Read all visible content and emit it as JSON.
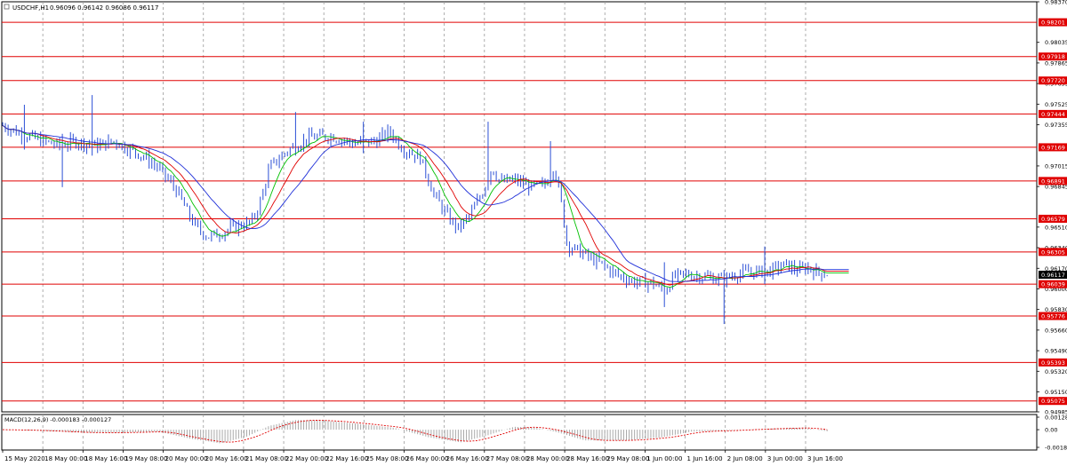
{
  "header": {
    "symbol_label": "USDCHF,H1",
    "ohlc_label": "0.96096 0.96142 0.96086 0.96117",
    "macd_label": "MACD(12,26,9) -0.000183 -0.000127"
  },
  "colors": {
    "candle": "#2b4fd6",
    "ma_fast": "#00c000",
    "ma_mid": "#e00000",
    "ma_slow": "#1f2fd8",
    "level_line": "#e00000",
    "level_tag_bg": "#e00000",
    "price_tag_bg": "#000000",
    "grid": "#9a9a9a",
    "macd_bar": "#aaaaaa",
    "macd_signal": "#e00000"
  },
  "chart_data": [
    {
      "type": "candlestick",
      "title": "USDCHF,H1",
      "ylim": [
        0.94985,
        0.9837
      ],
      "grid": true,
      "y_ticks": [
        "0.98370",
        "0.98201",
        "0.98035",
        "0.97918",
        "0.97865",
        "0.97720",
        "0.97695",
        "0.97525",
        "0.97444",
        "0.97355",
        "0.97169",
        "0.97015",
        "0.96891",
        "0.96845",
        "0.96579",
        "0.96510",
        "0.96305",
        "0.96340",
        "0.96170",
        "0.96117",
        "0.96039",
        "0.96000",
        "0.95830",
        "0.95776",
        "0.95660",
        "0.95490",
        "0.95393",
        "0.95320",
        "0.95150",
        "0.95075",
        "0.94985"
      ],
      "horizontal_levels": [
        "0.98201",
        "0.97918",
        "0.97720",
        "0.97444",
        "0.97169",
        "0.96891",
        "0.96579",
        "0.96305",
        "0.96039",
        "0.95776",
        "0.95393",
        "0.95075"
      ],
      "current_price": "0.96117",
      "x_labels": [
        "15 May 2020",
        "18 May 00:00",
        "18 May 16:00",
        "19 May 08:00",
        "20 May 00:00",
        "20 May 16:00",
        "21 May 08:00",
        "22 May 00:00",
        "22 May 16:00",
        "25 May 08:00",
        "26 May 00:00",
        "26 May 16:00",
        "27 May 08:00",
        "28 May 00:00",
        "28 May 16:00",
        "29 May 08:00",
        "1 Jun 00:00",
        "1 Jun 16:00",
        "2 Jun 08:00",
        "3 Jun 00:00",
        "3 Jun 16:00"
      ],
      "price_path": [
        {
          "x": 0,
          "y": 0.9735
        },
        {
          "x": 20,
          "y": 0.9728
        },
        {
          "x": 45,
          "y": 0.9722
        },
        {
          "x": 65,
          "y": 0.9718
        },
        {
          "x": 80,
          "y": 0.9722
        },
        {
          "x": 105,
          "y": 0.9718
        },
        {
          "x": 125,
          "y": 0.9722
        },
        {
          "x": 140,
          "y": 0.9716
        },
        {
          "x": 155,
          "y": 0.9711
        },
        {
          "x": 175,
          "y": 0.97
        },
        {
          "x": 195,
          "y": 0.9682
        },
        {
          "x": 210,
          "y": 0.966
        },
        {
          "x": 220,
          "y": 0.9649
        },
        {
          "x": 232,
          "y": 0.9643
        },
        {
          "x": 245,
          "y": 0.9646
        },
        {
          "x": 260,
          "y": 0.9651
        },
        {
          "x": 280,
          "y": 0.9655
        },
        {
          "x": 290,
          "y": 0.9672
        },
        {
          "x": 300,
          "y": 0.97
        },
        {
          "x": 320,
          "y": 0.9714
        },
        {
          "x": 345,
          "y": 0.9725
        },
        {
          "x": 370,
          "y": 0.9726
        },
        {
          "x": 395,
          "y": 0.972
        },
        {
          "x": 420,
          "y": 0.9722
        },
        {
          "x": 435,
          "y": 0.973
        },
        {
          "x": 450,
          "y": 0.9716
        },
        {
          "x": 470,
          "y": 0.9708
        },
        {
          "x": 485,
          "y": 0.9678
        },
        {
          "x": 500,
          "y": 0.966
        },
        {
          "x": 512,
          "y": 0.965
        },
        {
          "x": 525,
          "y": 0.966
        },
        {
          "x": 540,
          "y": 0.968
        },
        {
          "x": 550,
          "y": 0.97
        },
        {
          "x": 560,
          "y": 0.9688
        },
        {
          "x": 575,
          "y": 0.969
        },
        {
          "x": 595,
          "y": 0.9684
        },
        {
          "x": 610,
          "y": 0.9686
        },
        {
          "x": 620,
          "y": 0.9702
        },
        {
          "x": 628,
          "y": 0.9672
        },
        {
          "x": 635,
          "y": 0.9636
        },
        {
          "x": 650,
          "y": 0.963
        },
        {
          "x": 670,
          "y": 0.9622
        },
        {
          "x": 690,
          "y": 0.9612
        },
        {
          "x": 710,
          "y": 0.9606
        },
        {
          "x": 730,
          "y": 0.9605
        },
        {
          "x": 745,
          "y": 0.9598
        },
        {
          "x": 755,
          "y": 0.961
        },
        {
          "x": 770,
          "y": 0.9612
        },
        {
          "x": 790,
          "y": 0.961
        },
        {
          "x": 810,
          "y": 0.9608
        },
        {
          "x": 825,
          "y": 0.9612
        },
        {
          "x": 840,
          "y": 0.9614
        },
        {
          "x": 860,
          "y": 0.9614
        },
        {
          "x": 880,
          "y": 0.962
        },
        {
          "x": 895,
          "y": 0.9615
        },
        {
          "x": 905,
          "y": 0.9618
        },
        {
          "x": 915,
          "y": 0.9614
        },
        {
          "x": 930,
          "y": 0.9612
        }
      ],
      "spikes": [
        {
          "x": 25,
          "high": 0.9752,
          "low": 0.9715
        },
        {
          "x": 68,
          "high": 0.9728,
          "low": 0.9684
        },
        {
          "x": 100,
          "high": 0.976,
          "low": 0.971
        },
        {
          "x": 330,
          "high": 0.9746,
          "low": 0.971
        },
        {
          "x": 405,
          "high": 0.9738,
          "low": 0.9712
        },
        {
          "x": 547,
          "high": 0.9738,
          "low": 0.969
        },
        {
          "x": 615,
          "high": 0.9722,
          "low": 0.9684
        },
        {
          "x": 745,
          "high": 0.9622,
          "low": 0.9585
        },
        {
          "x": 810,
          "high": 0.9615,
          "low": 0.9571
        },
        {
          "x": 857,
          "high": 0.9635,
          "low": 0.9604
        }
      ]
    },
    {
      "type": "histogram",
      "title": "MACD(12,26,9)",
      "ylim": [
        -0.001812,
        0.00128
      ],
      "y_ticks": [
        "0.00128",
        "0.00",
        "-0.001812"
      ],
      "macd_path": [
        {
          "x": 0,
          "y": 0.0
        },
        {
          "x": 40,
          "y": -0.0001
        },
        {
          "x": 90,
          "y": -0.0003
        },
        {
          "x": 130,
          "y": -0.0003
        },
        {
          "x": 175,
          "y": -0.0002
        },
        {
          "x": 210,
          "y": -0.0009
        },
        {
          "x": 245,
          "y": -0.0014
        },
        {
          "x": 275,
          "y": -0.0007
        },
        {
          "x": 300,
          "y": 0.0004
        },
        {
          "x": 330,
          "y": 0.001
        },
        {
          "x": 365,
          "y": 0.0009
        },
        {
          "x": 400,
          "y": 0.0006
        },
        {
          "x": 440,
          "y": 0.0002
        },
        {
          "x": 480,
          "y": -0.0008
        },
        {
          "x": 515,
          "y": -0.0013
        },
        {
          "x": 545,
          "y": -0.0006
        },
        {
          "x": 575,
          "y": 0.0003
        },
        {
          "x": 600,
          "y": 0.0002
        },
        {
          "x": 625,
          "y": -0.0003
        },
        {
          "x": 655,
          "y": -0.0011
        },
        {
          "x": 700,
          "y": -0.0011
        },
        {
          "x": 740,
          "y": -0.0008
        },
        {
          "x": 775,
          "y": -0.0002
        },
        {
          "x": 810,
          "y": -0.0001
        },
        {
          "x": 860,
          "y": 0.0001
        },
        {
          "x": 900,
          "y": 0.0002
        },
        {
          "x": 930,
          "y": -0.0002
        }
      ]
    }
  ]
}
